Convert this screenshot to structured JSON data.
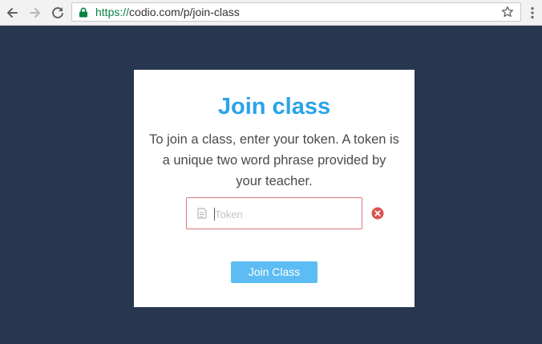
{
  "browser": {
    "url_scheme": "https://",
    "url_rest": "codio.com/p/join-class",
    "icons": {
      "back": "arrow-left-icon",
      "forward": "arrow-right-icon",
      "reload": "reload-icon",
      "lock": "lock-icon",
      "bookmark": "star-icon",
      "menu": "kebab-menu-icon"
    }
  },
  "dialog": {
    "title": "Join class",
    "description": "To join a class, enter your token. A token is a unique two word phrase provided by your teacher.",
    "token_placeholder": "Token",
    "token_value": "",
    "join_label": "Join Class"
  },
  "colors": {
    "background": "#283750",
    "title": "#2aa3ea",
    "button": "#5dbcf3",
    "error_border": "#d9797a",
    "error_icon": "#d9534f",
    "secure_green": "#0b8043"
  }
}
